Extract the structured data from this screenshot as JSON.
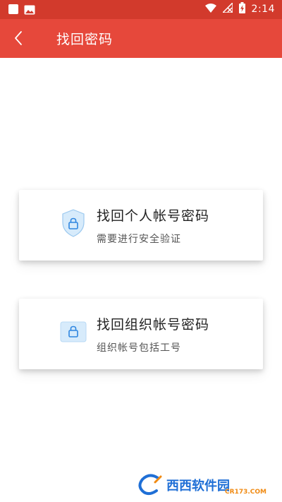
{
  "status_bar": {
    "time": "2:14",
    "left_icons": [
      "square-icon",
      "image-icon"
    ],
    "right_icons": [
      "wifi-icon",
      "no-signal-icon",
      "battery-charging-icon"
    ]
  },
  "app_bar": {
    "back_icon": "chevron-left-icon",
    "title": "找回密码",
    "color": "#e6483b"
  },
  "options": [
    {
      "title": "找回个人帐号密码",
      "subtitle": "需要进行安全验证",
      "icon": "shield-lock-icon"
    },
    {
      "title": "找回组织帐号密码",
      "subtitle": "组织帐号包括工号",
      "icon": "badge-lock-icon"
    }
  ],
  "watermark": {
    "text": "西西软件园",
    "sub": "CR173.COM"
  },
  "colors": {
    "status_bar": "#d23a2c",
    "accent_blue": "#2f86e0",
    "icon_bg": "#d7ebfb"
  }
}
